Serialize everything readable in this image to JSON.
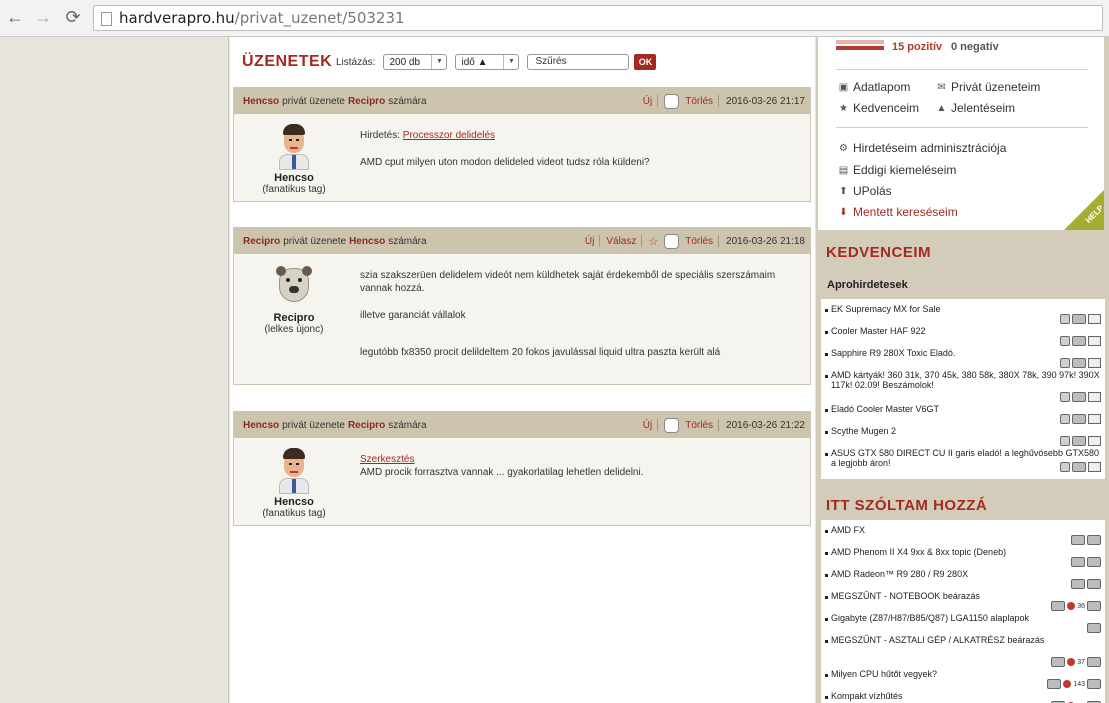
{
  "browser": {
    "back": "←",
    "forward": "→",
    "reload": "⟳",
    "url_host": "hardverapro.hu",
    "url_path": "/privat_uzenet/503231"
  },
  "main": {
    "title": "ÜZENETEK",
    "filters": {
      "label": "Listázás:",
      "count_value": "200 db",
      "sort_value": "idő ▲",
      "filter_placeholder": "Szűrés",
      "ok_label": "OK"
    },
    "messages": [
      {
        "from": "Hencso",
        "mid": "privát üzenete",
        "to": "Recipro",
        "suffix": "számára",
        "actions": {
          "new": "Új",
          "delete": "Törlés"
        },
        "date": "2016-03-26 21:17",
        "user": {
          "name": "Hencso",
          "rank": "(fanatikus tag)"
        },
        "ad_label": "Hirdetés:",
        "ad_link": "Processzor delidelés",
        "lines": [
          "AMD cput milyen uton modon delideled videot tudsz róla küldeni?"
        ]
      },
      {
        "from": "Recipro",
        "mid": "privát üzenete",
        "to": "Hencso",
        "suffix": "számára",
        "actions": {
          "new": "Új",
          "reply": "Válasz",
          "delete": "Törlés"
        },
        "date": "2016-03-26 21:18",
        "user": {
          "name": "Recipro",
          "rank": "(lelkes újonc)"
        },
        "lines": [
          "szia szakszerüen delidelem videót nem küldhetek saját érdekemből de speciális szerszámaim vannak hozzá.",
          "illetve garanciát vállalok",
          "legutóbb fx8350 procit delildeltem 20 fokos javulással liquid ultra paszta került alá"
        ]
      },
      {
        "from": "Hencso",
        "mid": "privát üzenete",
        "to": "Recipro",
        "suffix": "számára",
        "actions": {
          "new": "Új",
          "delete": "Törlés"
        },
        "date": "2016-03-26 21:22",
        "user": {
          "name": "Hencso",
          "rank": "(fanatikus tag)"
        },
        "edit_link": "Szerkesztés",
        "lines": [
          "AMD procik forrasztva vannak ... gyakorlatilag lehetlen delidelni."
        ]
      }
    ]
  },
  "sidebar": {
    "rating": {
      "positive": "15 pozitív",
      "negative": "0 negatív"
    },
    "links": {
      "profile": "Adatlapom",
      "private_messages": "Privát üzeneteim",
      "favorites": "Kedvenceim",
      "reports": "Jelentéseim",
      "ad_admin": "Hirdetéseim adminisztrációja",
      "highlights": "Eddigi kiemeléseim",
      "upload": "UPolás",
      "saved_searches": "Mentett kereséseim"
    },
    "help_label": "HELP",
    "favorites_title": "KEDVENCEIM",
    "favorites_sub": "Aprohirdetesek",
    "favorites_items": [
      "EK Supremacy MX for Sale",
      "Cooler Master HAF 922",
      "Sapphire R9 280X Toxic Eladó.",
      "AMD kártyák! 360 31k, 370 45k, 380 58k, 380X 78k, 390 97k! 390X 117k! 02.09! Beszámolok!",
      "Eladó Cooler Master V6GT",
      "Scythe Mugen 2",
      "ASUS GTX 580 DIRECT CU II garis eladó! a leghűvösebb GTX580 a legjobb áron!"
    ],
    "spoke_title": "ITT SZÓLTAM HOZZÁ",
    "spoke_items": [
      {
        "label": "AMD FX",
        "count": ""
      },
      {
        "label": "AMD Phenom II X4 9xx & 8xx topic (Deneb)",
        "count": ""
      },
      {
        "label": "AMD Radeon™ R9 280 / R9 280X",
        "count": ""
      },
      {
        "label": "MEGSZŰNT - NOTEBOOK beárazás",
        "count": "36"
      },
      {
        "label": "Gigabyte (Z87/H87/B85/Q87) LGA1150 alaplapok",
        "count": ""
      },
      {
        "label": "MEGSZŰNT - ASZTALI GÉP / ALKATRÉSZ beárazás",
        "count": "37"
      },
      {
        "label": "Milyen CPU hűtőt vegyek?",
        "count": "143"
      },
      {
        "label": "Kompakt vízhűtés",
        "count": "43"
      }
    ]
  },
  "colors": {
    "accent": "#a32a20",
    "header_bg": "#ccc4ad",
    "sidebar_bg": "#d3ccba"
  }
}
